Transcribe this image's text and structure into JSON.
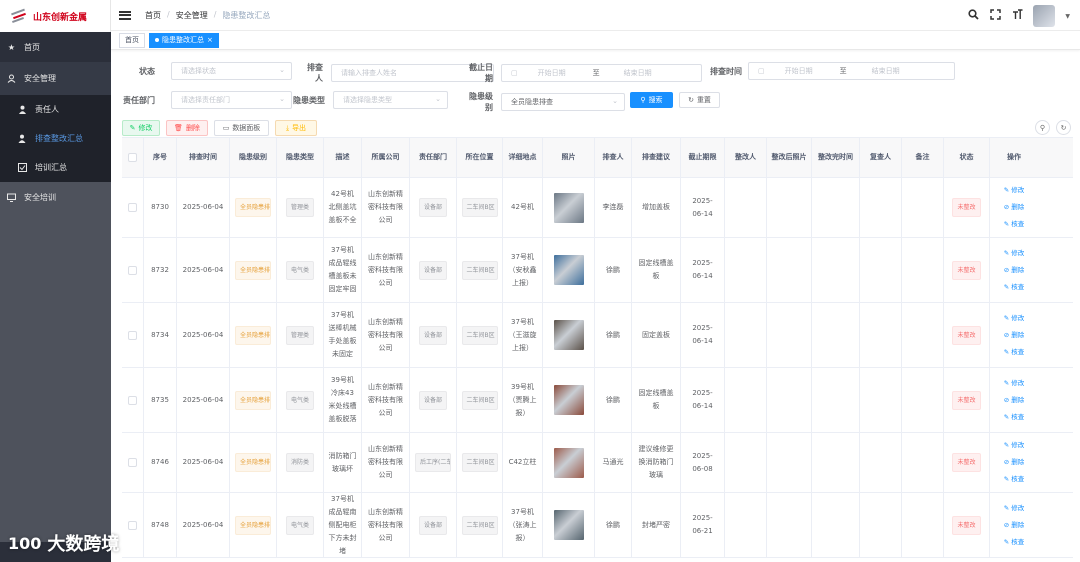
{
  "app": {
    "title": "山东创新金属"
  },
  "sidebar": {
    "items": [
      {
        "label": "首页",
        "icon": "home-icon"
      },
      {
        "label": "安全管理",
        "icon": "user-group-icon"
      },
      {
        "label": "责任人",
        "icon": "person-icon"
      },
      {
        "label": "排查整改汇总",
        "icon": "person-check-icon"
      },
      {
        "label": "培训汇总",
        "icon": "checkbox-icon"
      },
      {
        "label": "安全培训",
        "icon": "monitor-icon"
      }
    ]
  },
  "header": {
    "breadcrumb": [
      "首页",
      "安全管理",
      "隐患整改汇总"
    ],
    "separator": "/"
  },
  "tags": [
    {
      "label": "首页"
    },
    {
      "label": "隐患整改汇总",
      "close": "×"
    }
  ],
  "filters": {
    "status": {
      "label": "状态",
      "placeholder": "请选择状态"
    },
    "inspector": {
      "label": "排查人",
      "placeholder": "请输入排查人姓名"
    },
    "deadline": {
      "label": "截止日期",
      "start": "开始日期",
      "to": "至",
      "end": "结束日期"
    },
    "check_time": {
      "label": "排查时间",
      "start": "开始日期",
      "to": "至",
      "end": "结束日期"
    },
    "dept": {
      "label": "责任部门",
      "placeholder": "请选择责任部门"
    },
    "hazard_type": {
      "label": "隐患类型",
      "placeholder": "请选择隐患类型"
    },
    "hazard_level": {
      "label": "隐患级别",
      "value": "全员隐患排查"
    },
    "search_btn": "搜索",
    "reset_btn": "重置"
  },
  "toolbar": {
    "edit": "修改",
    "delete": "删除",
    "dashboard": "数据面板",
    "export": "导出"
  },
  "table": {
    "headers": [
      "序号",
      "排查时间",
      "隐患级别",
      "隐患类型",
      "描述",
      "所属公司",
      "责任部门",
      "所在位置",
      "详细地点",
      "照片",
      "排查人",
      "排查建议",
      "截止期限",
      "整改人",
      "整改后照片",
      "整改完时间",
      "复查人",
      "备注",
      "状态",
      "操作"
    ],
    "ops": {
      "edit": "修改",
      "delete": "删除",
      "review": "核查"
    },
    "rows": [
      {
        "id": "8730",
        "date": "2025-06-04",
        "level": "全员隐患排查",
        "type": "管理类",
        "desc": "42号机北侧盖坑盖板不全",
        "company": "山东创新精密科技有限公司",
        "dept": "设备部",
        "loc": "二车间B区",
        "place": "42号机",
        "inspector": "李连磊",
        "advice": "增加盖板",
        "deadline": "2025-06-14",
        "status": "未整改",
        "photo": "#6b7784"
      },
      {
        "id": "8732",
        "date": "2025-06-04",
        "level": "全员隐患排查",
        "type": "电气类",
        "desc": "37号机成品辊线槽盖板未固定牢固",
        "company": "山东创新精密科技有限公司",
        "dept": "设备部",
        "loc": "二车间B区",
        "place": "37号机（安秋鑫上报）",
        "inspector": "徐鹏",
        "advice": "固定线槽盖板",
        "deadline": "2025-06-14",
        "status": "未整改",
        "photo": "#3d6e9c"
      },
      {
        "id": "8734",
        "date": "2025-06-04",
        "level": "全员隐患排查",
        "type": "管理类",
        "desc": "37号机送棒机械手处盖板未固定",
        "company": "山东创新精密科技有限公司",
        "dept": "设备部",
        "loc": "二车间B区",
        "place": "37号机（王滋旋上报）",
        "inspector": "徐鹏",
        "advice": "固定盖板",
        "deadline": "2025-06-14",
        "status": "未整改",
        "photo": "#5a5048"
      },
      {
        "id": "8735",
        "date": "2025-06-04",
        "level": "全员隐患排查",
        "type": "电气类",
        "desc": "39号机冷床43米处线槽盖板脱落",
        "company": "山东创新精密科技有限公司",
        "dept": "设备部",
        "loc": "二车间B区",
        "place": "39号机（贾腾上报）",
        "inspector": "徐鹏",
        "advice": "固定线槽盖板",
        "deadline": "2025-06-14",
        "status": "未整改",
        "photo": "#8a4a3a"
      },
      {
        "id": "8746",
        "date": "2025-06-04",
        "level": "全员隐患排查",
        "type": "消防类",
        "desc": "消防箱门玻璃坏",
        "company": "山东创新精密科技有限公司",
        "dept": "后工序(二车",
        "loc": "二车间B区",
        "place": "C42立柱",
        "inspector": "马通光",
        "advice": "建议维修更换消防箱门玻璃",
        "deadline": "2025-06-08",
        "status": "未整改",
        "photo": "#9c5a4a"
      },
      {
        "id": "8748",
        "date": "2025-06-04",
        "level": "全员隐患排查",
        "type": "电气类",
        "desc": "37号机成品辊南侧配电柜下方未封堵",
        "company": "山东创新精密科技有限公司",
        "dept": "设备部",
        "loc": "二车间B区",
        "place": "37号机（张涛上报）",
        "inspector": "徐鹏",
        "advice": "封堵严密",
        "deadline": "2025-06-21",
        "status": "未整改",
        "photo": "#55646e"
      }
    ]
  },
  "watermark": {
    "text": "大数跨境",
    "logo": "100"
  }
}
